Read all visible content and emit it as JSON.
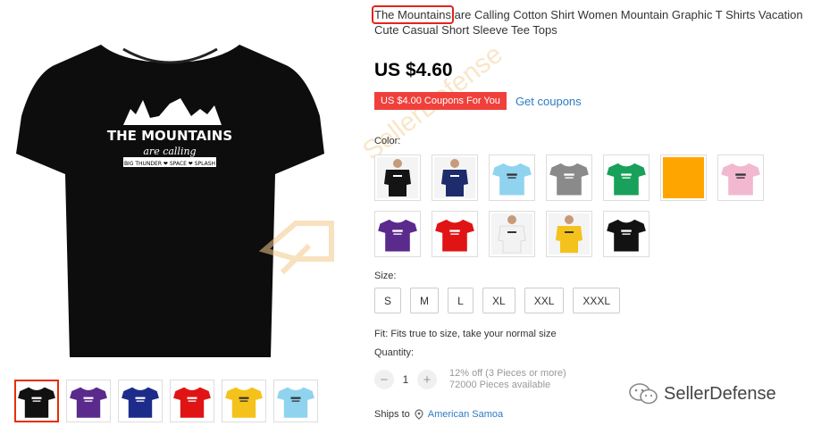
{
  "product": {
    "title_highlight": "The Mountains",
    "title_rest": " are Calling Cotton Shirt Women Mountain Graphic T Shirts Vacation Cute Casual Short Sleeve Tee Tops",
    "price": "US $4.60",
    "coupon_label": "US $4.00 Coupons For You",
    "get_coupons": "Get coupons",
    "shirt_print": {
      "line1": "THE MOUNTAINS",
      "line2": "are calling",
      "line3": "BIG THUNDER ❤ SPACE ❤ SPLASH"
    }
  },
  "color": {
    "label": "Color:",
    "options": [
      {
        "name": "black-model",
        "hex": "#141414",
        "photo": true
      },
      {
        "name": "navy-model",
        "hex": "#1d2c6b",
        "photo": true
      },
      {
        "name": "light-blue",
        "hex": "#8fd3ef",
        "photo": false
      },
      {
        "name": "gray",
        "hex": "#8a8a8a",
        "photo": false
      },
      {
        "name": "green",
        "hex": "#19a05a",
        "photo": false
      },
      {
        "name": "orange",
        "hex": "#ffa500",
        "solid": true
      },
      {
        "name": "pink",
        "hex": "#f2b8d0",
        "photo": false
      },
      {
        "name": "purple",
        "hex": "#5a2a8c",
        "photo": false
      },
      {
        "name": "red",
        "hex": "#e01414",
        "photo": false
      },
      {
        "name": "white-model",
        "hex": "#f2f2f2",
        "photo": true
      },
      {
        "name": "yellow-model",
        "hex": "#f5c21b",
        "photo": true
      },
      {
        "name": "black",
        "hex": "#121212",
        "photo": false
      }
    ]
  },
  "size": {
    "label": "Size:",
    "options": [
      "S",
      "M",
      "L",
      "XL",
      "XXL",
      "XXXL"
    ],
    "fit_note": "Fit: Fits true to size, take your normal size"
  },
  "quantity": {
    "label": "Quantity:",
    "value": "1",
    "minus": "−",
    "plus": "+",
    "discount": "12% off (3 Pieces or more)",
    "available": "72000 Pieces available"
  },
  "shipping": {
    "label": "Ships to",
    "location": "American Samoa"
  },
  "gallery": {
    "thumb_colors": [
      "#111111",
      "#5a2a8c",
      "#1d2c8a",
      "#e01414",
      "#f5c21b",
      "#8fd3ef"
    ]
  },
  "watermark": {
    "text": "SellerDefense",
    "brand": "SellerDefense"
  },
  "colors": {
    "accent_red": "#e1251b",
    "link_blue": "#2e7bc4",
    "coupon_bg": "#f0403b"
  }
}
